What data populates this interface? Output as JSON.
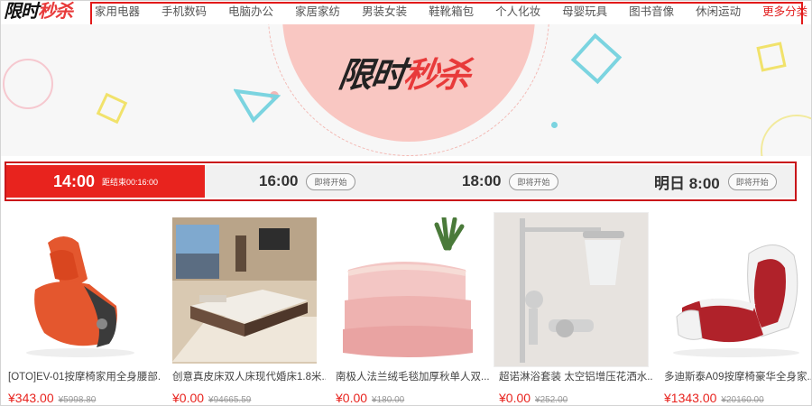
{
  "logo": {
    "part1": "限时",
    "part2": "秒杀"
  },
  "nav": {
    "items": [
      "家用电器",
      "手机数码",
      "电脑办公",
      "家居家纺",
      "男装女装",
      "鞋靴箱包",
      "个人化妆",
      "母婴玩具",
      "图书音像",
      "休闲运动"
    ],
    "more": "更多分类"
  },
  "banner": {
    "title_part1": "限时",
    "title_part2": "秒杀"
  },
  "time_tabs": [
    {
      "time": "14:00",
      "note": "距结束00:16:00"
    },
    {
      "time": "16:00",
      "button": "即将开始"
    },
    {
      "time": "18:00",
      "button": "即将开始"
    },
    {
      "time": "明日 8:00",
      "button": "即将开始"
    }
  ],
  "products": [
    {
      "name": "[OTO]EV-01按摩椅家用全身腰部...",
      "price": "¥343.00",
      "old_price": "¥5998.80",
      "icon": "massage-chair-image"
    },
    {
      "name": "创意真皮床双人床现代婚床1.8米...",
      "price": "¥0.00",
      "old_price": "¥94665.59",
      "icon": "bedroom-image"
    },
    {
      "name": "南极人法兰绒毛毯加厚秋单人双...",
      "price": "¥0.00",
      "old_price": "¥180.00",
      "icon": "blanket-image"
    },
    {
      "name": "超诺淋浴套装 太空铝增压花洒水...",
      "price": "¥0.00",
      "old_price": "¥252.00",
      "icon": "shower-set-image"
    },
    {
      "name": "多迪斯泰A09按摩椅豪华全身家...",
      "price": "¥1343.00",
      "old_price": "¥20160.00",
      "icon": "luxury-massage-chair-image"
    }
  ],
  "colors": {
    "accent": "#e8231e",
    "banner_bg": "#f7f7f7",
    "circle": "#f9c7c2"
  }
}
